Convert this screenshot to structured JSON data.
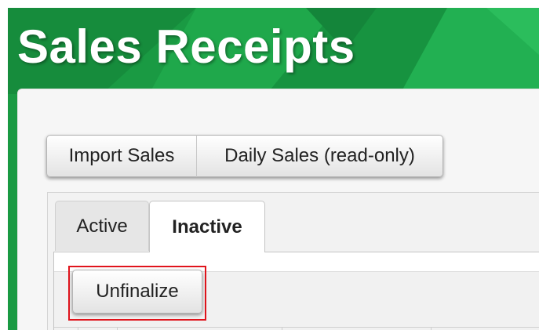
{
  "header": {
    "title": "Sales Receipts"
  },
  "toolbar": {
    "import_sales_label": "Import Sales",
    "daily_sales_label": "Daily Sales (read-only)"
  },
  "tabs": [
    {
      "label": "Active",
      "selected": false
    },
    {
      "label": "Inactive",
      "selected": true
    }
  ],
  "tab_toolbar": {
    "unfinalize_label": "Unfinalize"
  },
  "colors": {
    "header_green": "#1a9a43",
    "highlight_red": "#e0141c"
  }
}
